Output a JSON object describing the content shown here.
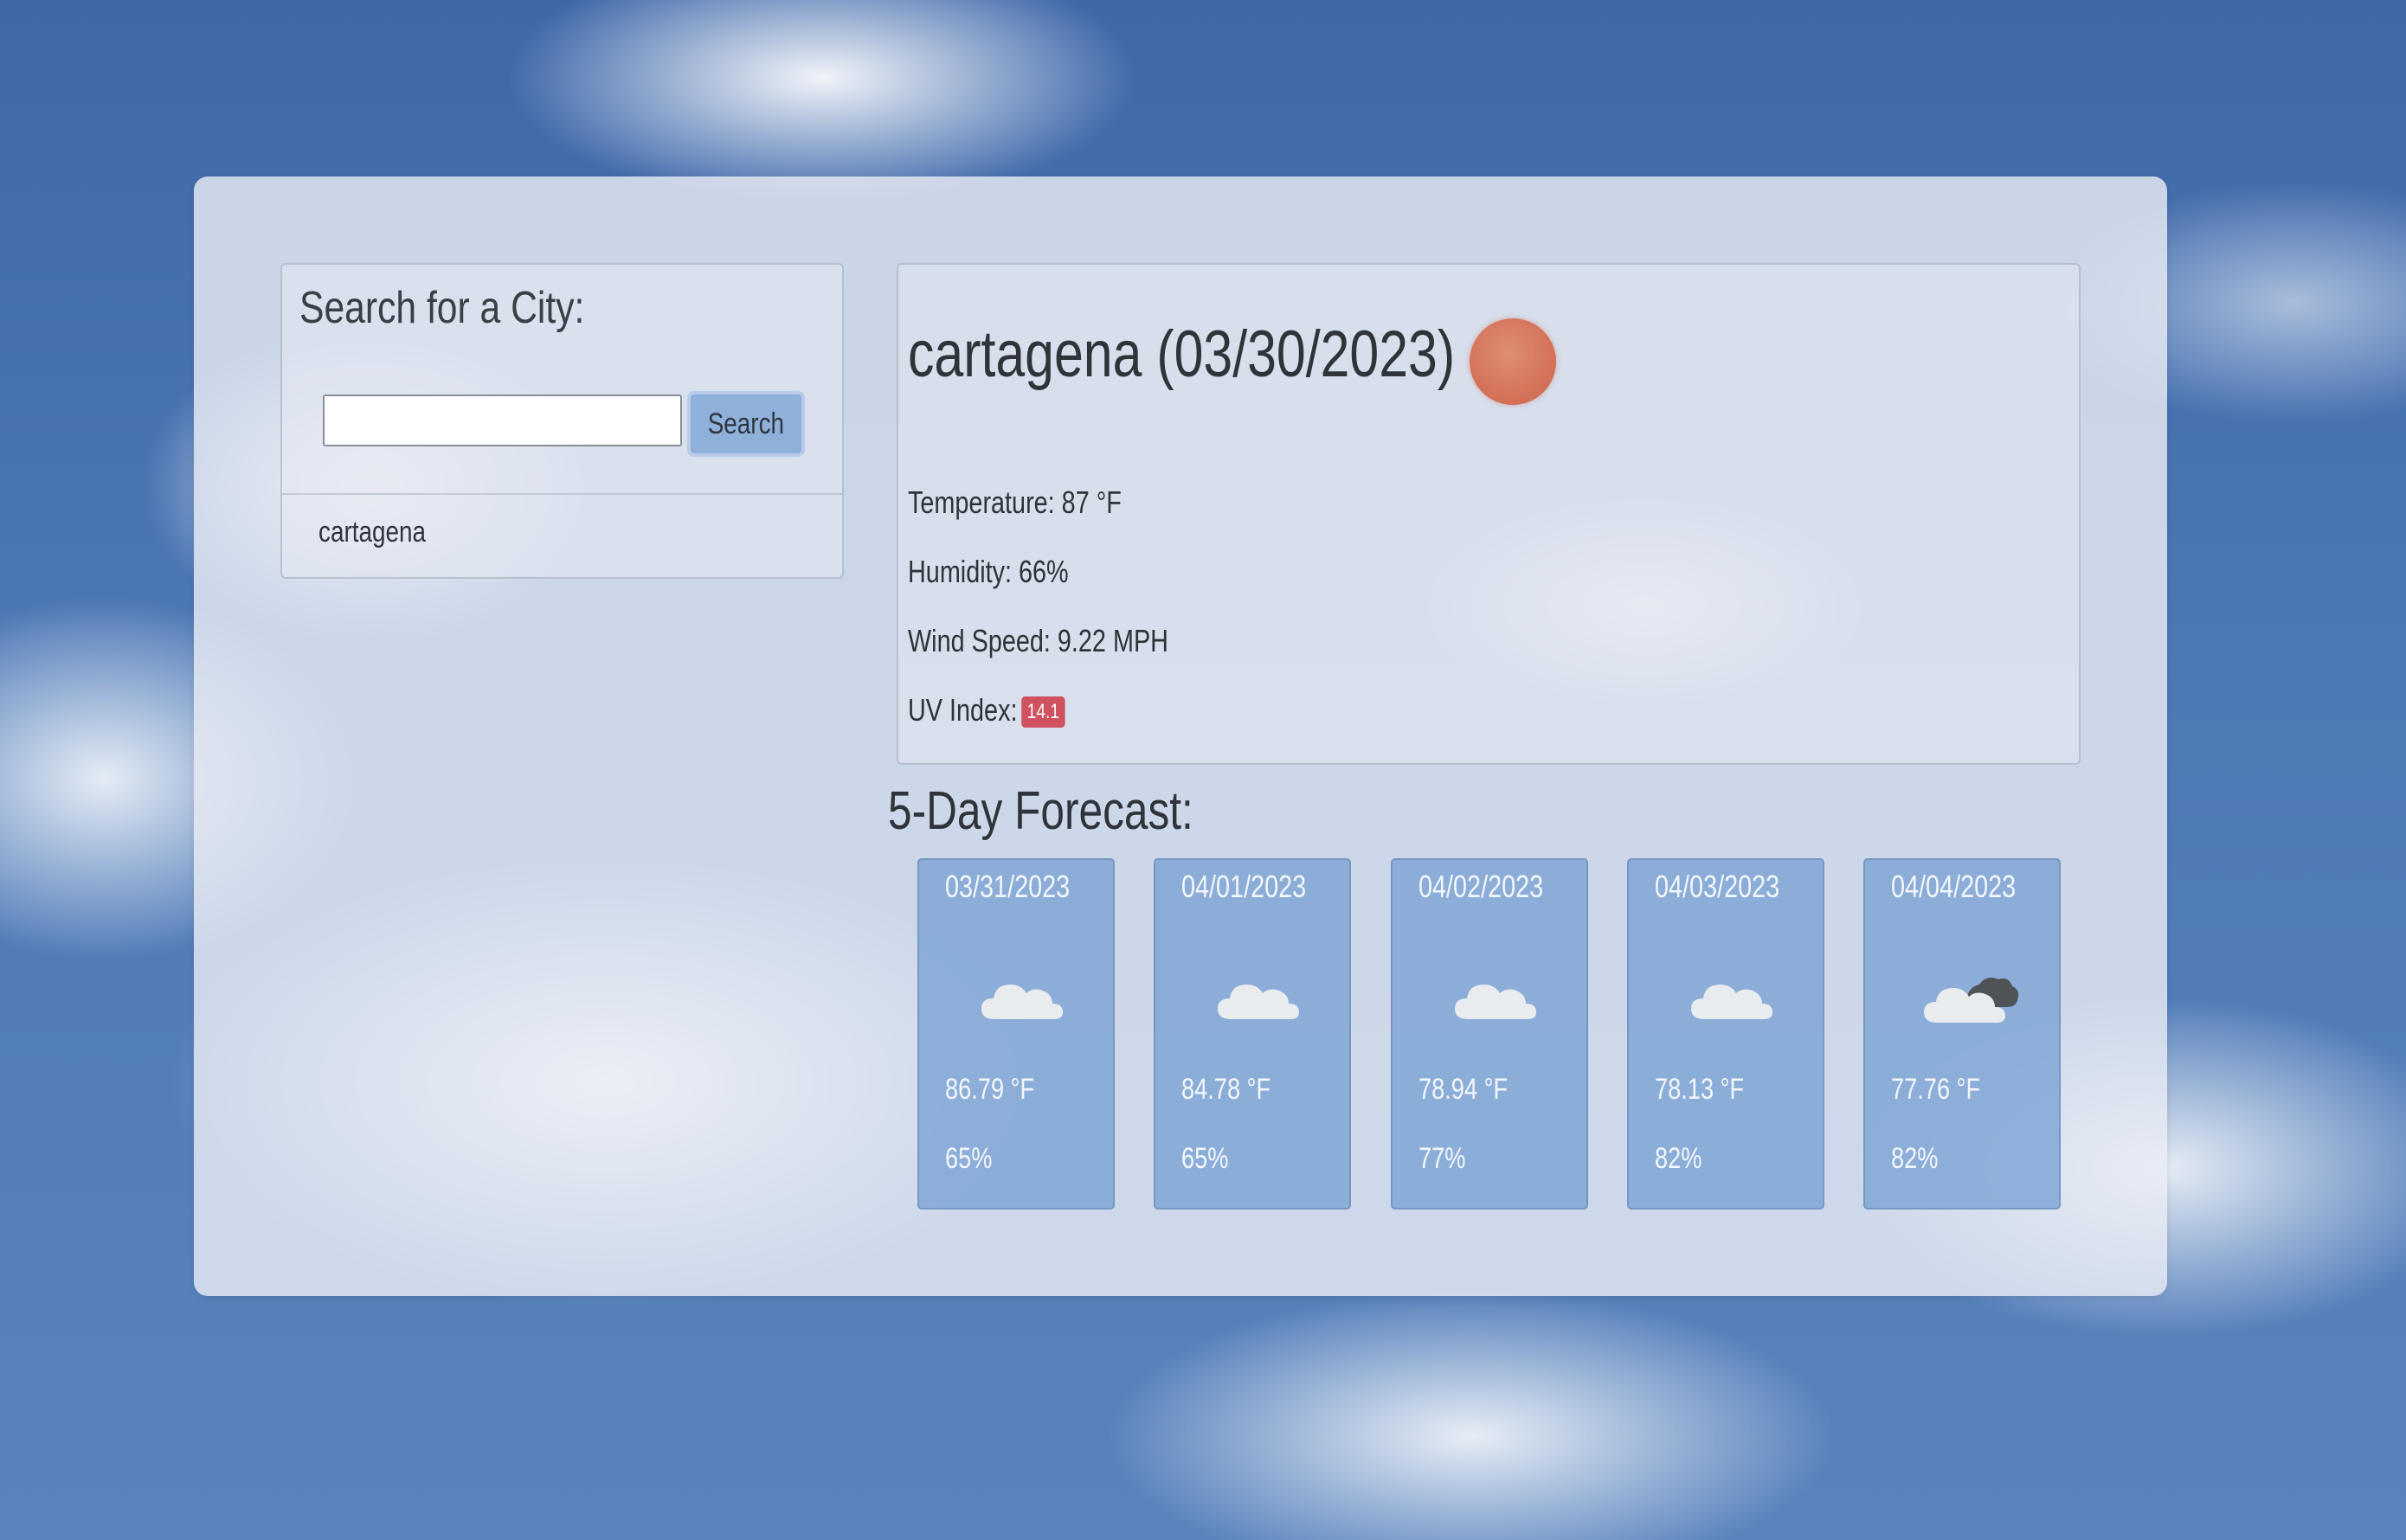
{
  "search": {
    "title": "Search for a City:",
    "input_value": "",
    "input_placeholder": "",
    "button_label": "Search",
    "history": [
      "cartagena"
    ]
  },
  "current": {
    "city_title": "cartagena (03/30/2023)",
    "icon": "clear-sun-icon",
    "temperature": "Temperature: 87 °F",
    "humidity": "Humidity: 66%",
    "wind": "Wind Speed: 9.22 MPH",
    "uv_label": "UV Index:",
    "uv_value": "14.1",
    "uv_color": "#d0525f"
  },
  "forecast": {
    "title": "5-Day Forecast:",
    "days": [
      {
        "date": "03/31/2023",
        "icon": "cloud-icon",
        "temp": "86.79 °F",
        "humidity": "65%"
      },
      {
        "date": "04/01/2023",
        "icon": "cloud-icon",
        "temp": "84.78 °F",
        "humidity": "65%"
      },
      {
        "date": "04/02/2023",
        "icon": "cloud-icon",
        "temp": "78.94 °F",
        "humidity": "77%"
      },
      {
        "date": "04/03/2023",
        "icon": "cloud-icon",
        "temp": "78.13 °F",
        "humidity": "82%"
      },
      {
        "date": "04/04/2023",
        "icon": "broken-clouds-icon",
        "temp": "77.76 °F",
        "humidity": "82%"
      }
    ]
  },
  "colors": {
    "card_blue": "#8eb0d9",
    "uv_badge": "#d0525f",
    "sun": "#d4735a"
  }
}
